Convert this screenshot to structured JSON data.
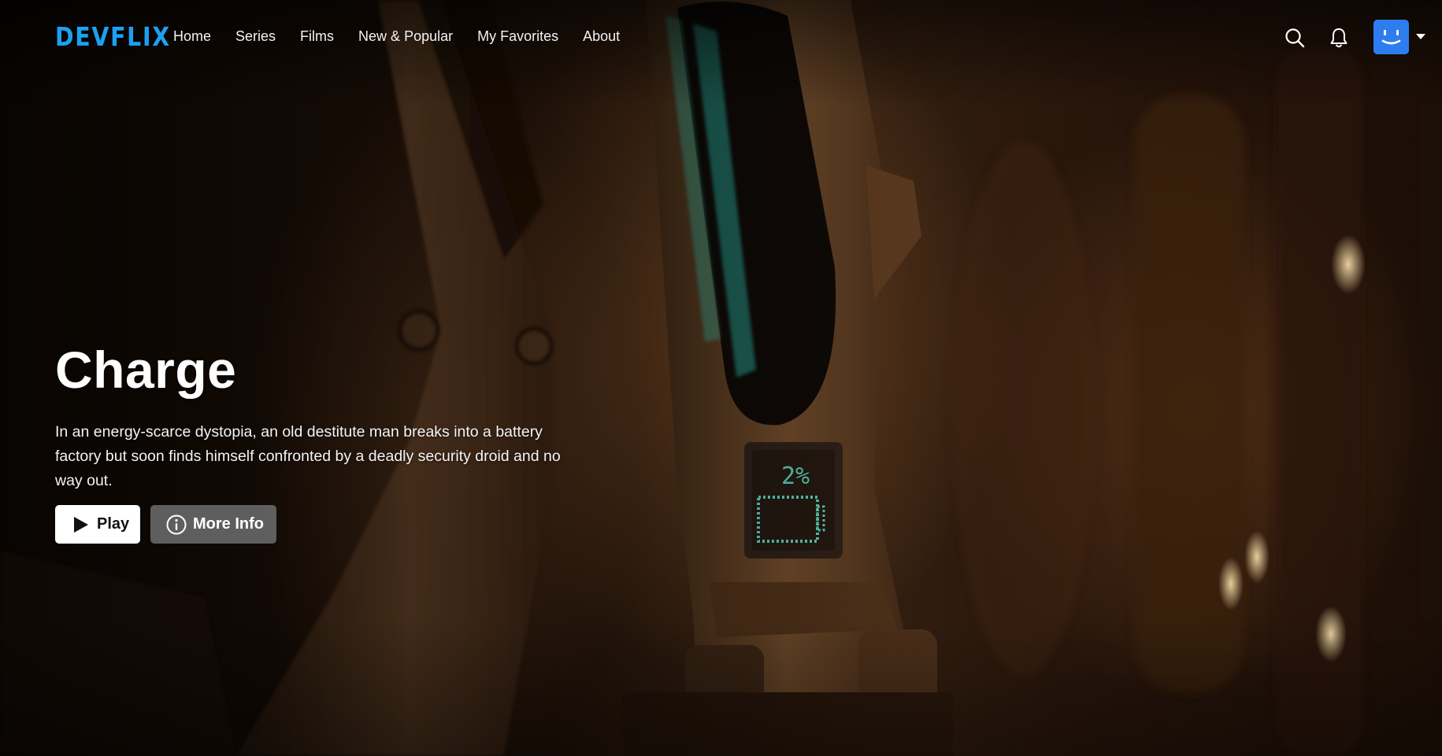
{
  "app": {
    "logo": "DEVFLIX"
  },
  "nav": {
    "links": [
      {
        "label": "Home"
      },
      {
        "label": "Series"
      },
      {
        "label": "Films"
      },
      {
        "label": "New & Popular"
      },
      {
        "label": "My Favorites"
      },
      {
        "label": "About"
      }
    ],
    "icons": {
      "search": "search-icon",
      "notifications": "bell-icon",
      "profile": "smiley-avatar",
      "menu": "caret-down-icon"
    }
  },
  "hero": {
    "title": "Charge",
    "description": "In an energy-scarce dystopia, an old destitute man breaks into a battery factory but soon finds himself confronted by a deadly security droid and no way out.",
    "play_label": "Play",
    "info_label": "More Info",
    "battery_readout": "2%"
  },
  "colors": {
    "brand": "#1ba1f2",
    "avatar": "#2e7df0",
    "screen_glow": "#2fc6b4"
  }
}
